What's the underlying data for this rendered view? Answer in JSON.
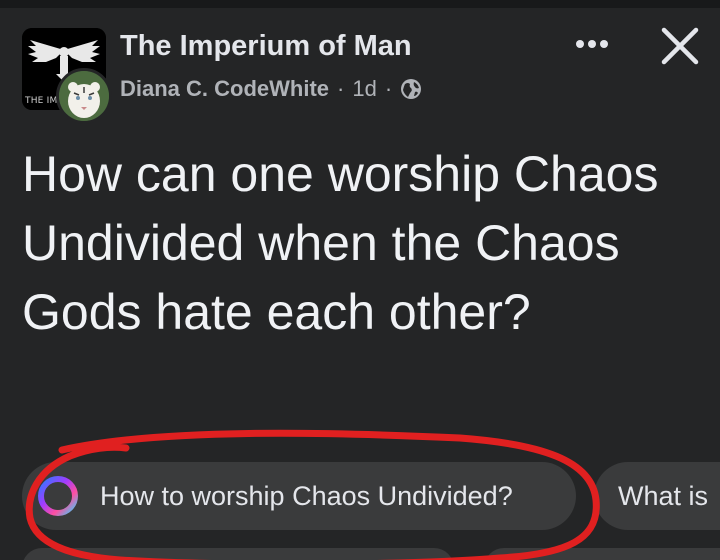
{
  "header": {
    "group_name": "The Imperium of Man",
    "group_avatar_caption": "THE IMPE",
    "author": "Diana C. CodeWhite",
    "time": "1d",
    "separator": "·",
    "privacy_icon": "globe-icon",
    "more_icon": "more-horizontal-icon",
    "close_icon": "close-icon"
  },
  "post": {
    "text": "How can one worship Chaos Undivided when the Chaos Gods hate each other?"
  },
  "suggestions": [
    {
      "label": "How to worship Chaos Undivided?",
      "icon": "meta-ai-icon"
    },
    {
      "label": "What is"
    }
  ],
  "annotation": {
    "color": "#e02020"
  }
}
